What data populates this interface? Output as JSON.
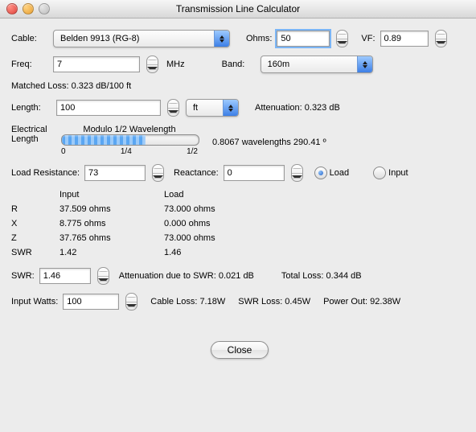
{
  "window": {
    "title": "Transmission Line Calculator"
  },
  "cable": {
    "label": "Cable:",
    "value": "Belden 9913 (RG-8)"
  },
  "ohms": {
    "label": "Ohms:",
    "value": "50"
  },
  "vf": {
    "label": "VF:",
    "value": "0.89"
  },
  "freq": {
    "label": "Freq:",
    "value": "7",
    "unit": "MHz"
  },
  "band": {
    "label": "Band:",
    "value": "160m"
  },
  "matched_loss": {
    "text": "Matched Loss: 0.323 dB/100 ft"
  },
  "length": {
    "label": "Length:",
    "value": "100",
    "unit": "ft"
  },
  "attenuation": {
    "text": "Attenuation: 0.323 dB"
  },
  "elec_length": {
    "label1": "Electrical",
    "label2": "Length",
    "caption": "Modulo 1/2 Wavelength",
    "ticks": [
      "0",
      "1/4",
      "1/2"
    ],
    "readout": "0.8067 wavelengths  290.41 º",
    "fraction_of_half": 0.613
  },
  "load_res": {
    "label": "Load Resistance:",
    "value": "73"
  },
  "reactance": {
    "label": "Reactance:",
    "value": "0"
  },
  "radios": {
    "load": "Load",
    "input": "Input",
    "selected": "Load"
  },
  "results": {
    "col_input": "Input",
    "col_load": "Load",
    "rows": [
      {
        "label": "R",
        "input": "37.509 ohms",
        "load": "73.000 ohms"
      },
      {
        "label": "X",
        "input": "8.775 ohms",
        "load": "0.000 ohms"
      },
      {
        "label": "Z",
        "input": "37.765 ohms",
        "load": "73.000 ohms"
      },
      {
        "label": "SWR",
        "input": "1.42",
        "load": "1.46"
      }
    ]
  },
  "swr": {
    "label": "SWR:",
    "value": "1.46"
  },
  "att_swr": {
    "text": "Attenuation due to SWR:  0.021 dB"
  },
  "total_loss": {
    "text": "Total Loss: 0.344 dB"
  },
  "watts": {
    "label": "Input Watts:",
    "value": "100"
  },
  "cable_loss": {
    "text": "Cable Loss: 7.18W"
  },
  "swr_loss": {
    "text": "SWR Loss: 0.45W"
  },
  "power_out": {
    "text": "Power Out: 92.38W"
  },
  "close": {
    "label": "Close"
  }
}
